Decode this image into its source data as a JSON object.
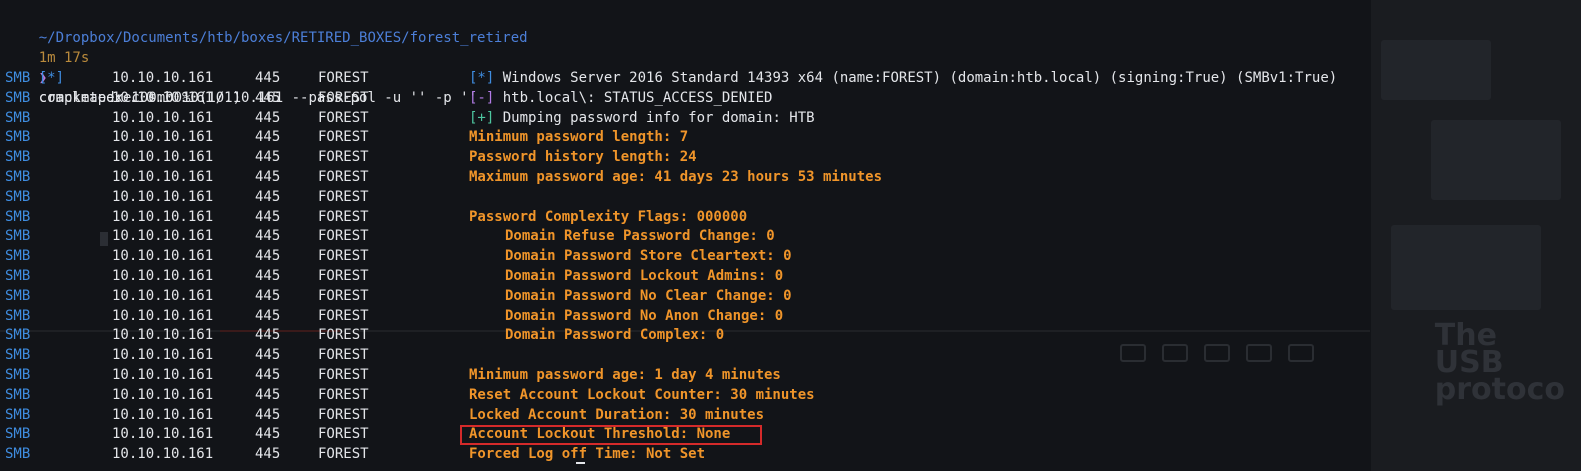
{
  "prompt": {
    "path": "~/Dropbox/Documents/htb/boxes/RETIRED_BOXES/forest_retired",
    "duration": "1m 17s",
    "arrow": "❯",
    "command": "crackmapexec smb 10.10.10.161 --pass-pol -u '' -p ''"
  },
  "progress": {
    "bracket": "[*]",
    "text": "completed: 100.00% (1/1)"
  },
  "rows": [
    {
      "proto": "SMB",
      "ip": "10.10.10.161",
      "port": "445",
      "host": "FOREST",
      "bracket": "[*]",
      "bracket_color": "blue",
      "msg": "Windows Server 2016 Standard 14393 x64 (name:FOREST) (domain:htb.local) (signing:True) (SMBv1:True)",
      "style": "white"
    },
    {
      "proto": "SMB",
      "ip": "10.10.10.161",
      "port": "445",
      "host": "FOREST",
      "bracket": "[-]",
      "bracket_color": "purple",
      "msg": "htb.local\\: STATUS_ACCESS_DENIED",
      "style": "white"
    },
    {
      "proto": "SMB",
      "ip": "10.10.10.161",
      "port": "445",
      "host": "FOREST",
      "bracket": "[+]",
      "bracket_color": "green",
      "msg": "Dumping password info for domain: HTB",
      "style": "white"
    },
    {
      "proto": "SMB",
      "ip": "10.10.10.161",
      "port": "445",
      "host": "FOREST",
      "bracket": "",
      "msg": "Minimum password length: 7",
      "style": "orange"
    },
    {
      "proto": "SMB",
      "ip": "10.10.10.161",
      "port": "445",
      "host": "FOREST",
      "bracket": "",
      "msg": "Password history length: 24",
      "style": "orange"
    },
    {
      "proto": "SMB",
      "ip": "10.10.10.161",
      "port": "445",
      "host": "FOREST",
      "bracket": "",
      "msg": "Maximum password age: 41 days 23 hours 53 minutes",
      "style": "orange"
    },
    {
      "proto": "SMB",
      "ip": "10.10.10.161",
      "port": "445",
      "host": "FOREST",
      "bracket": "",
      "msg": "",
      "style": "orange"
    },
    {
      "proto": "SMB",
      "ip": "10.10.10.161",
      "port": "445",
      "host": "FOREST",
      "bracket": "",
      "msg": "Password Complexity Flags: 000000",
      "style": "orange"
    },
    {
      "proto": "SMB",
      "ip": "10.10.10.161",
      "port": "445",
      "host": "FOREST",
      "bracket": "",
      "msg": "Domain Refuse Password Change: 0",
      "style": "orange-indent"
    },
    {
      "proto": "SMB",
      "ip": "10.10.10.161",
      "port": "445",
      "host": "FOREST",
      "bracket": "",
      "msg": "Domain Password Store Cleartext: 0",
      "style": "orange-indent"
    },
    {
      "proto": "SMB",
      "ip": "10.10.10.161",
      "port": "445",
      "host": "FOREST",
      "bracket": "",
      "msg": "Domain Password Lockout Admins: 0",
      "style": "orange-indent"
    },
    {
      "proto": "SMB",
      "ip": "10.10.10.161",
      "port": "445",
      "host": "FOREST",
      "bracket": "",
      "msg": "Domain Password No Clear Change: 0",
      "style": "orange-indent"
    },
    {
      "proto": "SMB",
      "ip": "10.10.10.161",
      "port": "445",
      "host": "FOREST",
      "bracket": "",
      "msg": "Domain Password No Anon Change: 0",
      "style": "orange-indent"
    },
    {
      "proto": "SMB",
      "ip": "10.10.10.161",
      "port": "445",
      "host": "FOREST",
      "bracket": "",
      "msg": "Domain Password Complex: 0",
      "style": "orange-indent"
    },
    {
      "proto": "SMB",
      "ip": "10.10.10.161",
      "port": "445",
      "host": "FOREST",
      "bracket": "",
      "msg": "",
      "style": "orange"
    },
    {
      "proto": "SMB",
      "ip": "10.10.10.161",
      "port": "445",
      "host": "FOREST",
      "bracket": "",
      "msg": "Minimum password age: 1 day 4 minutes",
      "style": "orange"
    },
    {
      "proto": "SMB",
      "ip": "10.10.10.161",
      "port": "445",
      "host": "FOREST",
      "bracket": "",
      "msg": "Reset Account Lockout Counter: 30 minutes",
      "style": "orange"
    },
    {
      "proto": "SMB",
      "ip": "10.10.10.161",
      "port": "445",
      "host": "FOREST",
      "bracket": "",
      "msg": "Locked Account Duration: 30 minutes",
      "style": "orange"
    },
    {
      "proto": "SMB",
      "ip": "10.10.10.161",
      "port": "445",
      "host": "FOREST",
      "bracket": "",
      "msg": "Account Lockout Threshold: None",
      "style": "orange"
    },
    {
      "proto": "SMB",
      "ip": "10.10.10.161",
      "port": "445",
      "host": "FOREST",
      "bracket": "",
      "msg": "Forced Log off Time: Not Set",
      "style": "orange"
    }
  ],
  "highlight_row_index": 18,
  "colors": {
    "background": "#121418",
    "smb_blue": "#3f8de0",
    "orange": "#f0952a",
    "highlight_red": "#d42a2a"
  }
}
